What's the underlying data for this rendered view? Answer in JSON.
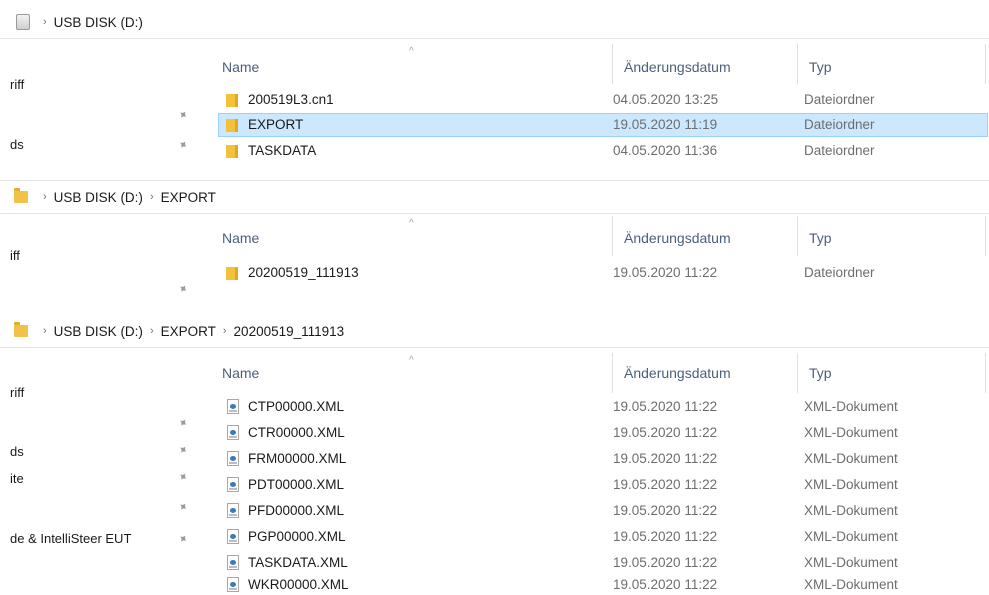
{
  "panel1": {
    "breadcrumb": [
      "USB DISK (D:)"
    ],
    "left_nav": [
      {
        "label": "riff",
        "pinned": false
      },
      {
        "label": "",
        "pinned": true
      },
      {
        "label": "ds",
        "pinned": true
      }
    ],
    "columns": {
      "name": "Name",
      "date": "Änderungsdatum",
      "type": "Typ"
    },
    "rows": [
      {
        "name": "200519L3.cn1",
        "date": "04.05.2020 13:25",
        "type": "Dateiordner",
        "icon": "folder-icon",
        "selected": false
      },
      {
        "name": "EXPORT",
        "date": "19.05.2020 11:19",
        "type": "Dateiordner",
        "icon": "folder-icon",
        "selected": true
      },
      {
        "name": "TASKDATA",
        "date": "04.05.2020 11:36",
        "type": "Dateiordner",
        "icon": "folder-icon",
        "selected": false
      }
    ]
  },
  "panel2": {
    "breadcrumb": [
      "USB DISK (D:)",
      "EXPORT"
    ],
    "left_nav": [
      {
        "label": "iff",
        "pinned": false
      },
      {
        "label": "",
        "pinned": true
      }
    ],
    "columns": {
      "name": "Name",
      "date": "Änderungsdatum",
      "type": "Typ"
    },
    "rows": [
      {
        "name": "20200519_111913",
        "date": "19.05.2020 11:22",
        "type": "Dateiordner",
        "icon": "folder-icon",
        "selected": false
      }
    ]
  },
  "panel3": {
    "breadcrumb": [
      "USB DISK (D:)",
      "EXPORT",
      "20200519_111913"
    ],
    "left_nav": [
      {
        "label": "riff",
        "pinned": false
      },
      {
        "label": "",
        "pinned": true
      },
      {
        "label": "ds",
        "pinned": true
      },
      {
        "label": "ite",
        "pinned": true
      },
      {
        "label": "",
        "pinned": true
      },
      {
        "label": "de & IntelliSteer EUT",
        "pinned": true
      }
    ],
    "columns": {
      "name": "Name",
      "date": "Änderungsdatum",
      "type": "Typ"
    },
    "rows": [
      {
        "name": "CTP00000.XML",
        "date": "19.05.2020 11:22",
        "type": "XML-Dokument",
        "icon": "xml-file-icon"
      },
      {
        "name": "CTR00000.XML",
        "date": "19.05.2020 11:22",
        "type": "XML-Dokument",
        "icon": "xml-file-icon"
      },
      {
        "name": "FRM00000.XML",
        "date": "19.05.2020 11:22",
        "type": "XML-Dokument",
        "icon": "xml-file-icon"
      },
      {
        "name": "PDT00000.XML",
        "date": "19.05.2020 11:22",
        "type": "XML-Dokument",
        "icon": "xml-file-icon"
      },
      {
        "name": "PFD00000.XML",
        "date": "19.05.2020 11:22",
        "type": "XML-Dokument",
        "icon": "xml-file-icon"
      },
      {
        "name": "PGP00000.XML",
        "date": "19.05.2020 11:22",
        "type": "XML-Dokument",
        "icon": "xml-file-icon"
      },
      {
        "name": "TASKDATA.XML",
        "date": "19.05.2020 11:22",
        "type": "XML-Dokument",
        "icon": "xml-file-icon"
      },
      {
        "name": "WKR00000.XML",
        "date": "19.05.2020 11:22",
        "type": "XML-Dokument",
        "icon": "xml-file-icon"
      }
    ]
  },
  "icons": {
    "breadcrumb_separator": "›",
    "pin": "📌",
    "sort_indicator": "^"
  }
}
